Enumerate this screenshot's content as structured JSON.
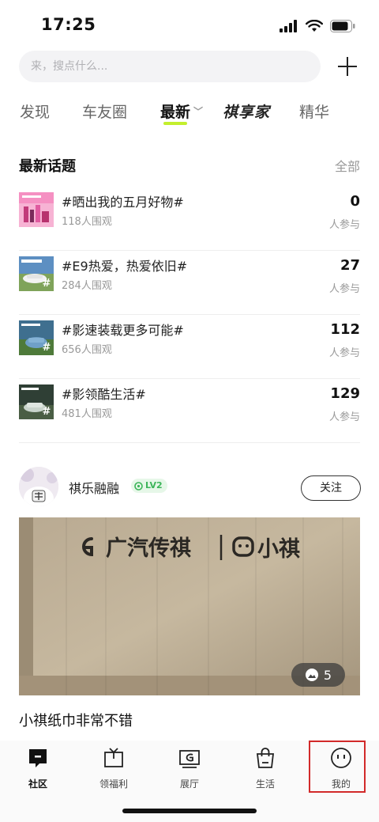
{
  "status_bar": {
    "time": "17:25"
  },
  "search": {
    "placeholder": "来，搜点什么..."
  },
  "tabs": [
    {
      "label": "发现"
    },
    {
      "label": "车友圈"
    },
    {
      "label": "最新",
      "active": true
    },
    {
      "label": "祺享家"
    },
    {
      "label": "精华"
    }
  ],
  "topics_section": {
    "title": "最新话题",
    "all_label": "全部",
    "participants_caption": "人参与",
    "items": [
      {
        "name": "#晒出我的五月好物#",
        "views": "118人围观",
        "count": "0"
      },
      {
        "name": "#E9热爱，热爱依旧#",
        "views": "284人围观",
        "count": "27"
      },
      {
        "name": "#影速装载更多可能#",
        "views": "656人围观",
        "count": "112"
      },
      {
        "name": "#影领酷生活#",
        "views": "481人围观",
        "count": "129"
      }
    ]
  },
  "post": {
    "username": "祺乐融融",
    "level": "LV2",
    "follow_label": "关注",
    "image_count": "5",
    "photo_text_brand": "广汽传祺",
    "photo_text_sub": "小祺",
    "title": "小祺纸巾非常不错"
  },
  "bottom_nav": {
    "items": [
      {
        "label": "社区",
        "icon": "community-icon",
        "active": true
      },
      {
        "label": "领福利",
        "icon": "gift-icon"
      },
      {
        "label": "展厅",
        "icon": "showroom-icon"
      },
      {
        "label": "生活",
        "icon": "shopping-bag-icon"
      },
      {
        "label": "我的",
        "icon": "profile-icon"
      }
    ]
  },
  "colors": {
    "accent": "#c3ef2d",
    "highlight_box": "#d22a2a",
    "level_badge": "#3db55a"
  }
}
